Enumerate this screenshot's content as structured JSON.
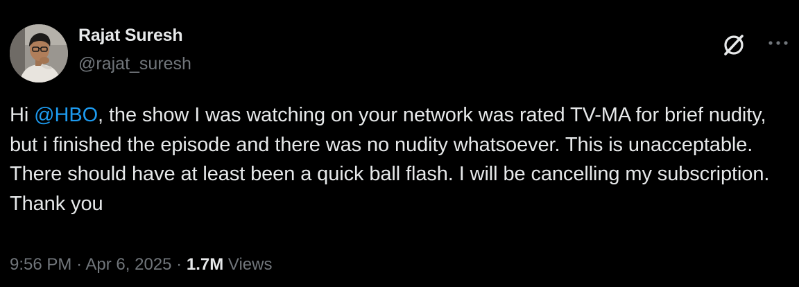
{
  "author": {
    "display_name": "Rajat Suresh",
    "handle": "@rajat_suresh"
  },
  "actions": {
    "grok_icon": "grok-icon",
    "more_icon": "more-icon"
  },
  "tweet": {
    "text_before": "Hi ",
    "mention": "@HBO",
    "text_after": ", the show I was watching on your network was rated TV-MA for brief nudity, but i finished the episode and there was no nudity whatsoever. This is unacceptable. There should have at least been a quick ball flash. I will be cancelling my subscription. Thank you"
  },
  "meta": {
    "time": "9:56 PM",
    "separator": "·",
    "date": "Apr 6, 2025",
    "views_count": "1.7M",
    "views_label": "Views"
  },
  "colors": {
    "background": "#000000",
    "text": "#e7e9ea",
    "secondary": "#71767b",
    "accent": "#1d9bf0"
  }
}
